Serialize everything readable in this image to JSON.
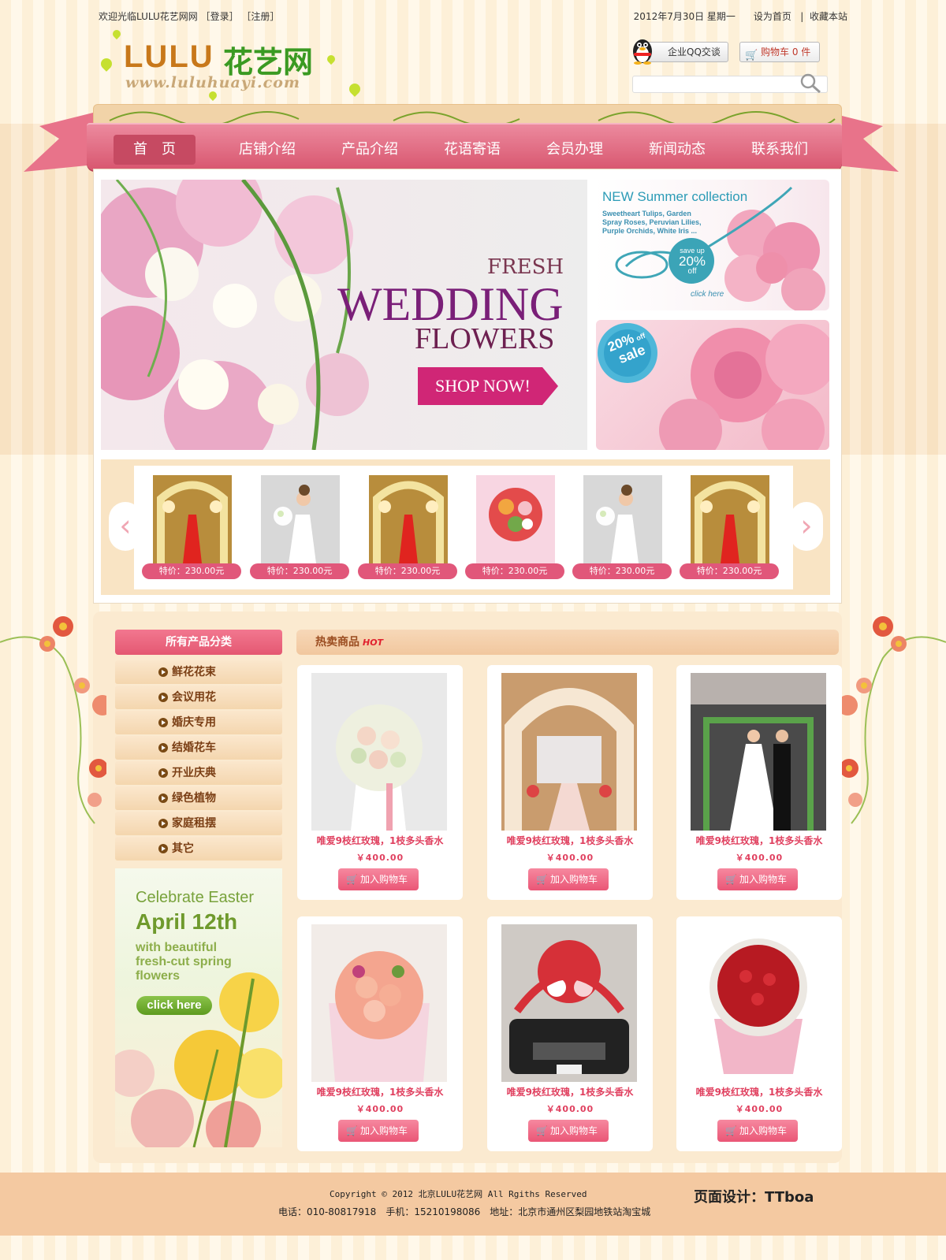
{
  "topbar": {
    "welcome": "欢迎光临LULU花艺网网",
    "login": "［登录］",
    "register": "［注册］",
    "date": "2012年7月30日 星期一",
    "set_home": "设为首页",
    "separator": "|",
    "bookmark": "收藏本站"
  },
  "logo": {
    "latin": "LULU",
    "cn": "花艺网",
    "url": "www.luluhuayi.com"
  },
  "qq": {
    "label": "企业QQ交谈"
  },
  "cart": {
    "label": "购物车 0 件"
  },
  "search": {
    "placeholder": ""
  },
  "nav": {
    "items": [
      "首　页",
      "店铺介绍",
      "产品介绍",
      "花语寄语",
      "会员办理",
      "新闻动态",
      "联系我们"
    ]
  },
  "banner": {
    "fresh": "FRESH",
    "wedding": "WEDDING",
    "flowers": "FLOWERS",
    "shop_now": "SHOP NOW!"
  },
  "side_promo1": {
    "title": "NEW Summer collection",
    "desc": "Sweetheart Tulips, Garden Spray Roses, Peruvian Lilies, Purple Orchids, White Iris ...",
    "save": "save up",
    "pct": "20%",
    "off": "off",
    "click": "click here"
  },
  "side_promo2": {
    "pct": "20%",
    "off": "off",
    "sale": "sale"
  },
  "carousel": {
    "items": [
      {
        "price": "特价：230.00元",
        "kind": "aisle"
      },
      {
        "price": "特价：230.00元",
        "kind": "bride"
      },
      {
        "price": "特价：230.00元",
        "kind": "aisle"
      },
      {
        "price": "特价：230.00元",
        "kind": "bouquet"
      },
      {
        "price": "特价：230.00元",
        "kind": "bride"
      },
      {
        "price": "特价：230.00元",
        "kind": "aisle"
      }
    ]
  },
  "categories": {
    "title": "所有产品分类",
    "items": [
      "鲜花花束",
      "会议用花",
      "婚庆专用",
      "结婚花车",
      "开业庆典",
      "绿色植物",
      "家庭租摆",
      "其它"
    ]
  },
  "easter": {
    "line1": "Celebrate Easter",
    "line2": "April 12th",
    "line3": "with beautiful fresh-cut spring flowers",
    "button": "click here"
  },
  "hot": {
    "title": "热卖商品",
    "badge": "HOT",
    "products": [
      {
        "name": "唯爱9枝红玫瑰，1枝多头香水",
        "price": "￥400.00",
        "button": "加入购物车",
        "kind": "white-bouquet"
      },
      {
        "name": "唯爱9枝红玫瑰，1枝多头香水",
        "price": "￥400.00",
        "button": "加入购物车",
        "kind": "arch"
      },
      {
        "name": "唯爱9枝红玫瑰，1枝多头香水",
        "price": "￥400.00",
        "button": "加入购物车",
        "kind": "ceremony"
      },
      {
        "name": "唯爱9枝红玫瑰，1枝多头香水",
        "price": "￥400.00",
        "button": "加入购物车",
        "kind": "peach-bouquet"
      },
      {
        "name": "唯爱9枝红玫瑰，1枝多头香水",
        "price": "￥400.00",
        "button": "加入购物车",
        "kind": "car"
      },
      {
        "name": "唯爱9枝红玫瑰，1枝多头香水",
        "price": "￥400.00",
        "button": "加入购物车",
        "kind": "red-bouquet"
      }
    ]
  },
  "footer": {
    "copyright": "Copyright © 2012 北京LULU花艺网 All Rgiths Reserved",
    "contact": "电话：010-80817918　手机：15210198086　地址：北京市通州区梨园地铁站淘宝城",
    "design": "页面设计：TTboa"
  },
  "colors": {
    "brand_pink": "#e45872",
    "nav_pink": "#d8566f",
    "cream": "#fdf3df",
    "tan": "#f4c9a1",
    "logo_green": "#3a9a22",
    "logo_orange": "#c8781a"
  }
}
